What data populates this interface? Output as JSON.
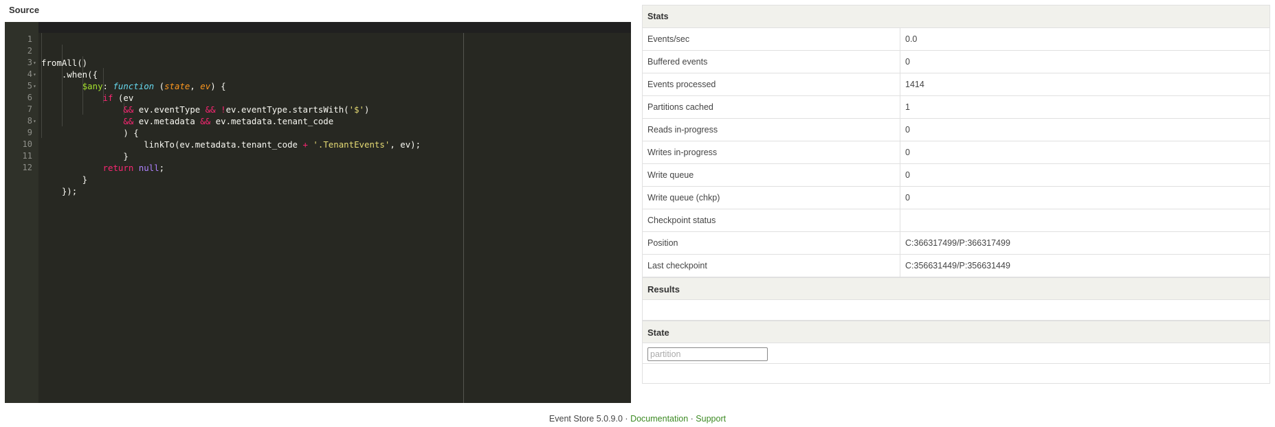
{
  "source": {
    "title": "Source",
    "lines": [
      {
        "n": "1",
        "fold": ""
      },
      {
        "n": "2",
        "fold": "▾"
      },
      {
        "n": "3",
        "fold": "▾"
      },
      {
        "n": "4",
        "fold": "▾"
      },
      {
        "n": "5",
        "fold": ""
      },
      {
        "n": "6",
        "fold": ""
      },
      {
        "n": "7",
        "fold": "▾"
      },
      {
        "n": "8",
        "fold": ""
      },
      {
        "n": "9",
        "fold": ""
      },
      {
        "n": "10",
        "fold": ""
      },
      {
        "n": "11",
        "fold": ""
      },
      {
        "n": "12",
        "fold": ""
      }
    ],
    "code": {
      "l1_a": "fromAll()",
      "l2_a": "    .when({",
      "l3_indent": "        ",
      "l3_prop": "$any",
      "l3_colon": ": ",
      "l3_fn": "function",
      "l3_open": " (",
      "l3_p1": "state",
      "l3_comma": ", ",
      "l3_p2": "ev",
      "l3_close": ") {",
      "l4_indent": "            ",
      "l4_kw": "if",
      "l4_rest": " (ev",
      "l5_indent": "                ",
      "l5_and1": "&&",
      "l5_mid1": " ev.eventType ",
      "l5_and2": "&&",
      "l5_sp": " ",
      "l5_not": "!",
      "l5_mid2": "ev.eventType.startsWith(",
      "l5_str": "'$'",
      "l5_end": ")",
      "l6_indent": "                ",
      "l6_and1": "&&",
      "l6_mid1": " ev.metadata ",
      "l6_and2": "&&",
      "l6_mid2": " ev.metadata.tenant_code",
      "l7_a": "                ) {",
      "l8_indent": "                    ",
      "l8_a": "linkTo(ev.metadata.tenant_code ",
      "l8_plus": "+",
      "l8_sp": " ",
      "l8_str": "'.TenantEvents'",
      "l8_end": ", ev);",
      "l9_a": "                }",
      "l10_indent": "            ",
      "l10_kw": "return",
      "l10_sp": " ",
      "l10_null": "null",
      "l10_end": ";",
      "l11_a": "        }",
      "l12_a": "    });"
    }
  },
  "stats": {
    "header": "Stats",
    "rows": [
      {
        "label": "Events/sec",
        "value": "0.0"
      },
      {
        "label": "Buffered events",
        "value": "0"
      },
      {
        "label": "Events processed",
        "value": "1414"
      },
      {
        "label": "Partitions cached",
        "value": "1"
      },
      {
        "label": "Reads in-progress",
        "value": "0"
      },
      {
        "label": "Writes in-progress",
        "value": "0"
      },
      {
        "label": "Write queue",
        "value": "0"
      },
      {
        "label": "Write queue (chkp)",
        "value": "0"
      },
      {
        "label": "Checkpoint status",
        "value": ""
      },
      {
        "label": "Position",
        "value": "C:366317499/P:366317499"
      },
      {
        "label": "Last checkpoint",
        "value": "C:356631449/P:356631449"
      }
    ]
  },
  "results": {
    "header": "Results"
  },
  "state": {
    "header": "State",
    "partition_placeholder": "partition",
    "partition_value": ""
  },
  "footer": {
    "version": "Event Store 5.0.9.0",
    "sep": "·",
    "documentation": "Documentation",
    "support": "Support"
  }
}
